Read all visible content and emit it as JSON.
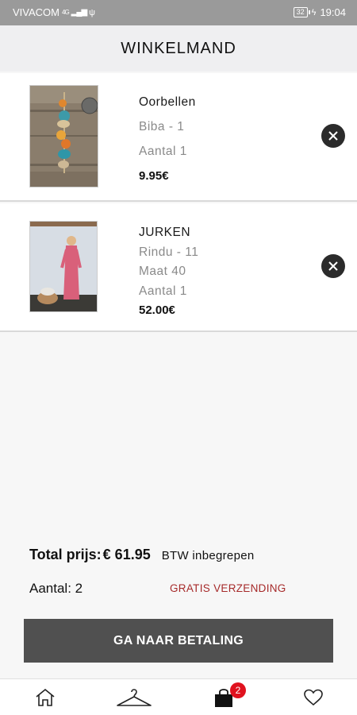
{
  "status_bar": {
    "carrier": "VIVACOM",
    "network": "4G",
    "battery": "32",
    "time": "19:04"
  },
  "header": {
    "title": "WINKELMAND"
  },
  "cart": {
    "items": [
      {
        "name": "Oorbellen",
        "variant": "Biba - 1",
        "quantity": "Aantal 1",
        "price": "9.95€"
      },
      {
        "name": "JURKEN",
        "variant": "Rindu - 11",
        "size": "Maat 40",
        "quantity": "Aantal 1",
        "price": "52.00€"
      }
    ]
  },
  "summary": {
    "total_label": "Total prijs:",
    "total_value": "€ 61.95",
    "vat_note": "BTW inbegrepen",
    "count": "Aantal: 2",
    "shipping": "GRATIS VERZENDING"
  },
  "checkout": {
    "label": "GA NAAR BETALING"
  },
  "bottom_nav": {
    "items": [
      {
        "icon": "home-icon"
      },
      {
        "icon": "hanger-icon"
      },
      {
        "icon": "shopping-bag-icon",
        "badge": "2"
      },
      {
        "icon": "heart-icon"
      }
    ]
  },
  "colors": {
    "status_bar": "#9a9a9a",
    "header_bg": "#efeff1",
    "checkout_button": "#505050",
    "shipping_text": "#a62a2a",
    "badge": "#e0121f"
  }
}
